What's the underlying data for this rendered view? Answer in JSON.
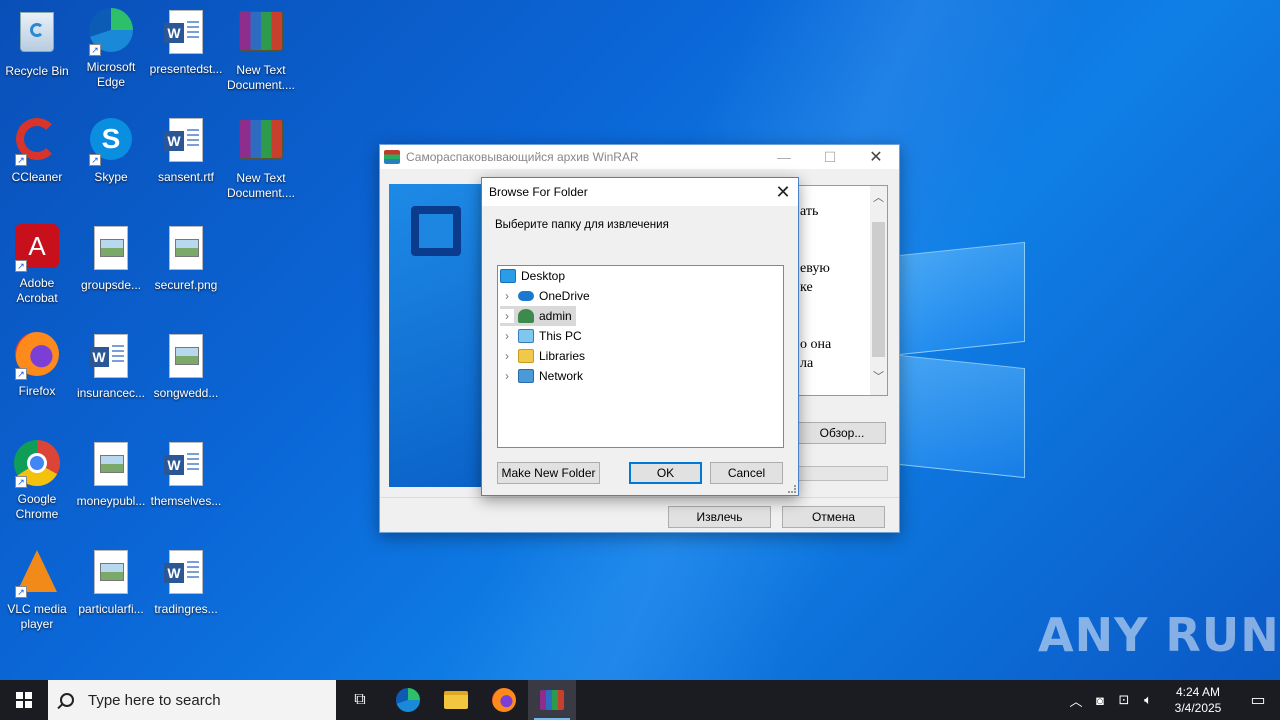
{
  "desktop": {
    "icons": [
      {
        "label": "Recycle Bin",
        "icon": "recycle-bin-icon"
      },
      {
        "label": "Microsoft Edge",
        "icon": "edge-icon"
      },
      {
        "label": "presentedst...",
        "icon": "word-doc-icon"
      },
      {
        "label": "New Text Document....",
        "icon": "winrar-archive-icon"
      },
      {
        "label": "CCleaner",
        "icon": "ccleaner-icon"
      },
      {
        "label": "Skype",
        "icon": "skype-icon"
      },
      {
        "label": "sansent.rtf",
        "icon": "word-doc-icon"
      },
      {
        "label": "New Text Document....",
        "icon": "winrar-archive-icon"
      },
      {
        "label": "Adobe Acrobat",
        "icon": "acrobat-icon"
      },
      {
        "label": "groupsde...",
        "icon": "image-file-icon"
      },
      {
        "label": "securef.png",
        "icon": "image-file-icon"
      },
      {
        "label": "Firefox",
        "icon": "firefox-icon"
      },
      {
        "label": "insurancec...",
        "icon": "word-doc-icon"
      },
      {
        "label": "songwedd...",
        "icon": "image-file-icon"
      },
      {
        "label": "Google Chrome",
        "icon": "chrome-icon"
      },
      {
        "label": "moneypubl...",
        "icon": "image-file-icon"
      },
      {
        "label": "themselves...",
        "icon": "word-doc-icon"
      },
      {
        "label": "VLC media player",
        "icon": "vlc-icon"
      },
      {
        "label": "particularfi...",
        "icon": "image-file-icon"
      },
      {
        "label": "tradingres...",
        "icon": "word-doc-icon"
      }
    ]
  },
  "winrar_window": {
    "title": "Самораспаковывающийся архив WinRAR",
    "text_fragments": [
      "ать",
      "евую",
      "ке",
      "о она",
      "ла"
    ],
    "browse_button": "Обзор...",
    "extract_button": "Извлечь",
    "cancel_button": "Отмена"
  },
  "browse_dialog": {
    "title": "Browse For Folder",
    "instruction": "Выберите папку для извлечения",
    "tree": [
      {
        "label": "Desktop",
        "icon": "desktop-folder-icon",
        "expandable": false
      },
      {
        "label": "OneDrive",
        "icon": "onedrive-icon",
        "expandable": true
      },
      {
        "label": "admin",
        "icon": "user-folder-icon",
        "expandable": true,
        "selected": true
      },
      {
        "label": "This PC",
        "icon": "computer-icon",
        "expandable": true
      },
      {
        "label": "Libraries",
        "icon": "libraries-icon",
        "expandable": true
      },
      {
        "label": "Network",
        "icon": "network-icon",
        "expandable": true
      }
    ],
    "new_folder_button": "Make New Folder",
    "ok_button": "OK",
    "cancel_button": "Cancel"
  },
  "taskbar": {
    "search_placeholder": "Type here to search",
    "apps": [
      "task-view-icon",
      "edge-icon",
      "file-explorer-icon",
      "firefox-icon",
      "winrar-icon"
    ],
    "clock_time": "4:24 AM",
    "clock_date": "3/4/2025"
  },
  "watermark": "ANY RUN"
}
